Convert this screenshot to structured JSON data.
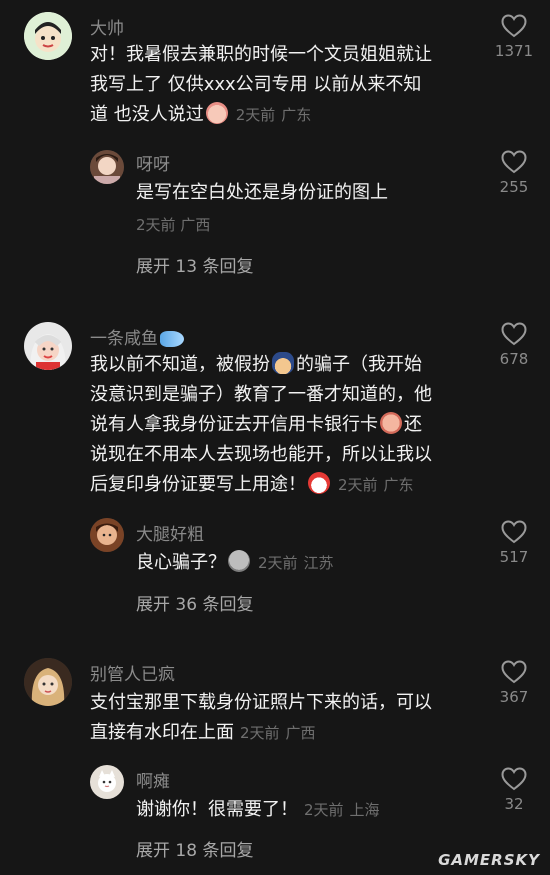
{
  "comments": [
    {
      "author": "大帅",
      "lines": [
        "对！我暑假去兼职的时候一个文员姐姐就让",
        "我写上了 仅供xxx公司专用 以前从来不知",
        "道 也没人说过"
      ],
      "emoji": "baby-face-emoji",
      "time": "2天前",
      "location": "广东",
      "likes": "1371",
      "reply": {
        "author": "呀呀",
        "text": "是写在空白处还是身份证的图上",
        "time": "2天前",
        "location": "广西",
        "likes": "255"
      },
      "expand_label": "展开 13 条回复"
    },
    {
      "author": "一条咸鱼",
      "author_emoji": "fish-emoji",
      "lines": [
        "我以前不知道，被假扮",
        "的骗子（我开始",
        "没意识到是骗子）教育了一番才知道的，他",
        "说有人拿我身份证去开信用卡银行卡",
        "还",
        "说现在不用本人去现场也能开，所以让我以",
        "后复印身份证要写上用途！"
      ],
      "time": "2天前",
      "location": "广东",
      "likes": "678",
      "reply": {
        "author": "大腿好粗",
        "text": "良心骗子？",
        "time": "2天前",
        "location": "江苏",
        "likes": "517"
      },
      "expand_label": "展开 36 条回复"
    },
    {
      "author": "别管人已疯",
      "lines": [
        "支付宝那里下载身份证照片下来的话，可以",
        "直接有水印在上面"
      ],
      "time": "2天前",
      "location": "广西",
      "likes": "367",
      "reply": {
        "author": "啊瘫",
        "text": "谢谢你！很需要了！",
        "time": "2天前",
        "location": "上海",
        "likes": "32"
      },
      "expand_label": "展开 18 条回复"
    }
  ],
  "watermark": "GAMERSKY",
  "colors": {
    "background": "#161616",
    "text": "#f2f2f2",
    "muted": "#6f6f6f",
    "name": "#8a8a8a"
  }
}
